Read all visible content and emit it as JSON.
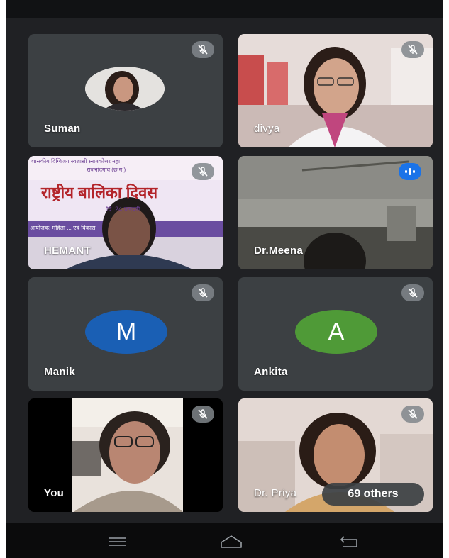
{
  "participants": [
    {
      "name": "Suman",
      "muted": true,
      "view": "photo-avatar"
    },
    {
      "name": "divya",
      "muted": true,
      "view": "video"
    },
    {
      "name": "HEMANT",
      "muted": true,
      "view": "video"
    },
    {
      "name": "Dr.Meena",
      "muted": false,
      "speaking": true,
      "view": "video"
    },
    {
      "name": "Manik",
      "muted": true,
      "view": "letter-avatar",
      "avatar_letter": "M",
      "avatar_color": "#1a5fb4"
    },
    {
      "name": "Ankita",
      "muted": true,
      "view": "letter-avatar",
      "avatar_letter": "A",
      "avatar_color": "#4f9a37"
    },
    {
      "name": "You",
      "muted": true,
      "view": "video"
    },
    {
      "name": "Dr. Priya",
      "muted": true,
      "view": "video"
    }
  ],
  "others_label": "69 others",
  "banner": {
    "line1": "शासकीय दिग्विजय स्वशासी स्नातकोत्तर महा",
    "line2": "राजनांदगांव (छ.ग.)",
    "title": "राष्ट्रीय बालिका दिवस",
    "line3": "दि. 24 जनवरी",
    "line4": "आयोजक: महिला ... एवं विकास"
  },
  "colors": {
    "background": "#202124",
    "tile": "#3c4043",
    "speaking_indicator": "#1a73e8",
    "mute_badge": "#80868b"
  },
  "icons": [
    "mic-off-icon",
    "speaking-icon",
    "menu-icon",
    "home-icon",
    "back-icon"
  ]
}
